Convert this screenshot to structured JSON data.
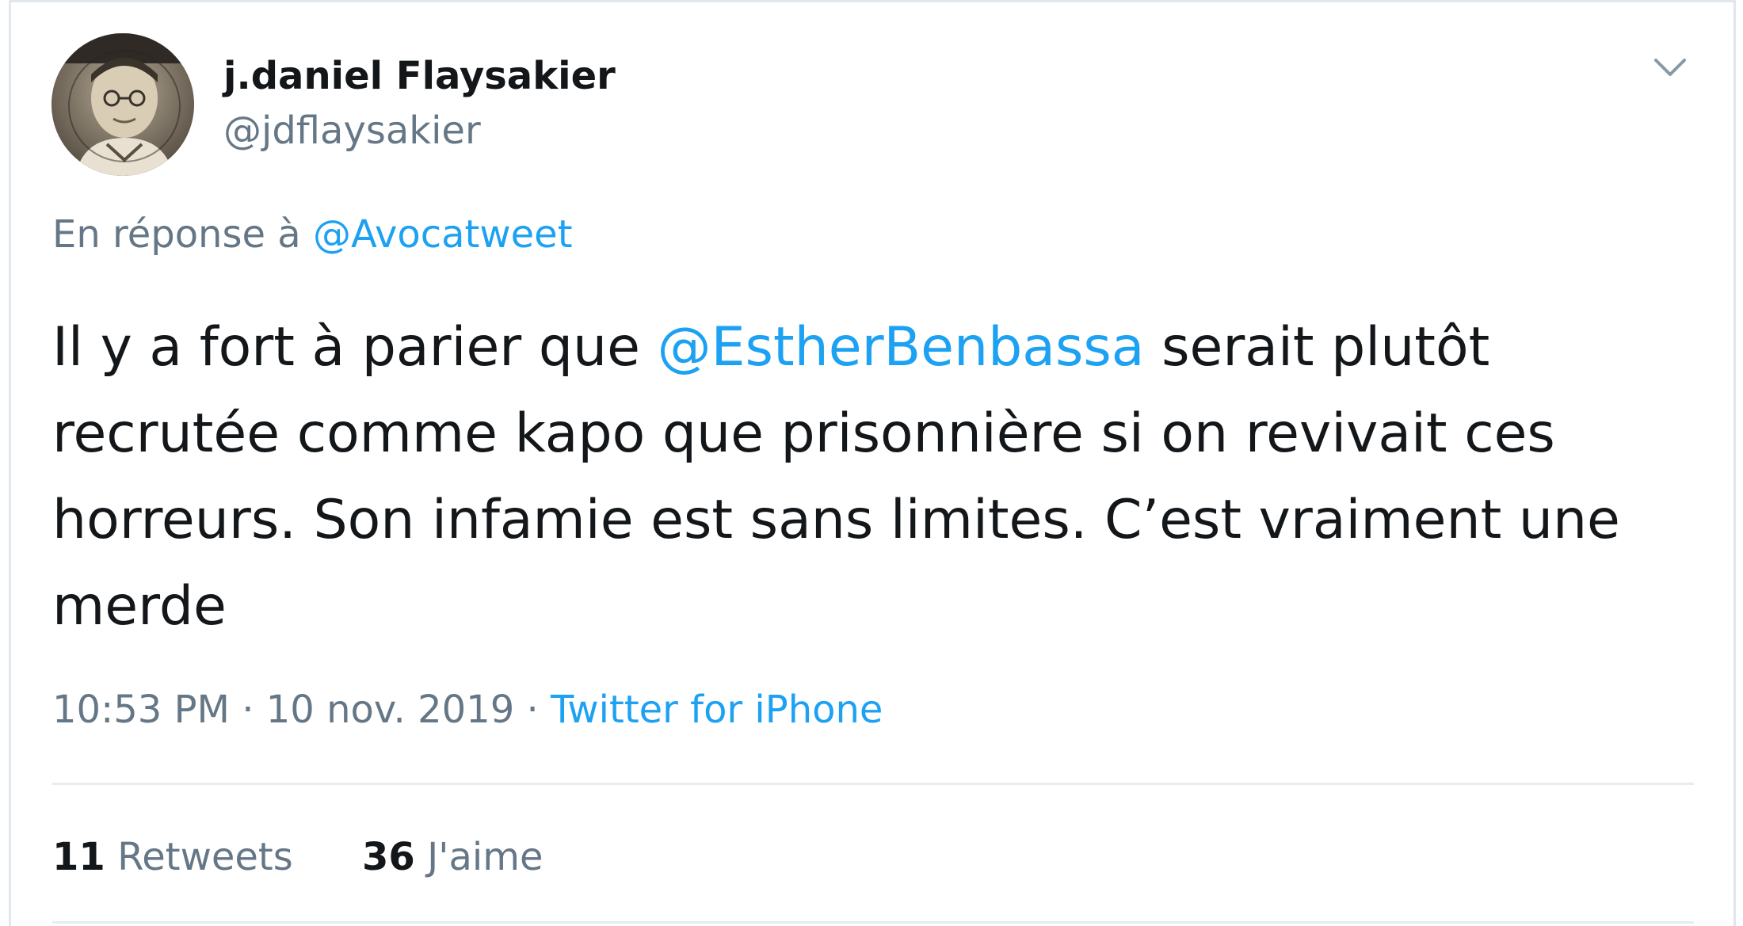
{
  "author": {
    "display_name": "j.daniel Flaysakier",
    "handle": "@jdflaysakier"
  },
  "reply": {
    "prefix": "En réponse à",
    "to_handle": "@Avocatweet"
  },
  "tweet": {
    "text_before_mention": "Il y a fort à parier que ",
    "mention": "@EstherBenbassa",
    "text_after_mention": " serait plutôt recrutée comme kapo que prisonnière si on revivait ces horreurs. Son infamie est sans limites. C’est vraiment une merde"
  },
  "meta": {
    "time": "10:53 PM",
    "separator1": "·",
    "date": "10 nov. 2019",
    "separator2": "·",
    "source": "Twitter for iPhone"
  },
  "stats": {
    "retweets_count": "11",
    "retweets_label": "Retweets",
    "likes_count": "36",
    "likes_label": "J'aime"
  },
  "icons": {
    "menu": "chevron-down-icon",
    "avatar": "profile-photo"
  },
  "colors": {
    "link": "#1da1f2",
    "text": "#14171a",
    "secondary": "#657786",
    "border": "#e1e8ed"
  }
}
